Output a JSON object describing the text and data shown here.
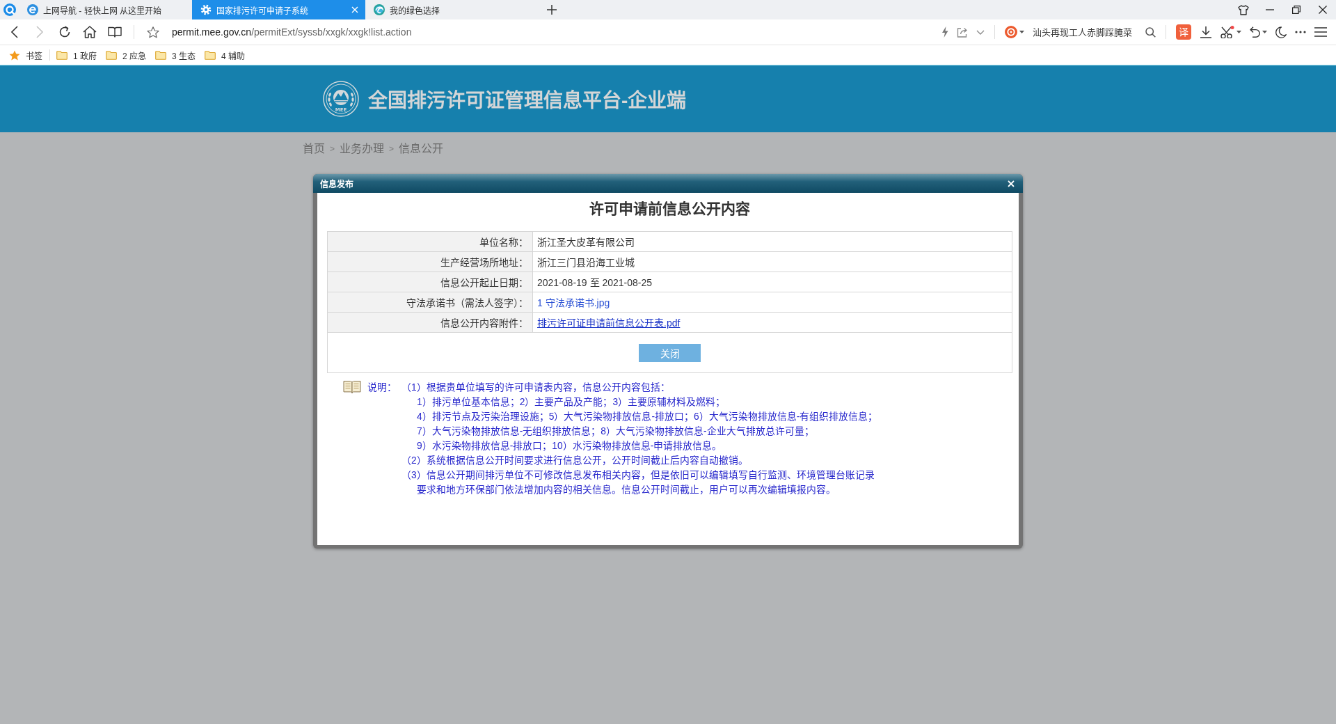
{
  "browser": {
    "tabs": [
      {
        "title": "上网导航 - 轻快上网 从这里开始",
        "kind": "letter",
        "selected": false
      },
      {
        "title": "国家排污许可申请子系统",
        "kind": "gear",
        "selected": true
      },
      {
        "title": "我的绿色选择",
        "kind": "globe",
        "selected": false
      }
    ],
    "forward_disabled": true,
    "address": {
      "domain": "permit.mee.gov.cn",
      "path": "/permitExt/syssb/xxgk/xxgk!list.action"
    },
    "search": {
      "placeholder": "汕头再现工人赤脚踩腌菜"
    },
    "translate_label": "译",
    "bookmarks": [
      {
        "label": "书签",
        "kind": "star"
      },
      {
        "label": "1 政府",
        "kind": "folder"
      },
      {
        "label": "2 应急",
        "kind": "folder"
      },
      {
        "label": "3 生态",
        "kind": "folder"
      },
      {
        "label": "4 辅助",
        "kind": "folder"
      }
    ]
  },
  "header": {
    "logo_text": "MEE",
    "title": "全国排污许可证管理信息平台-企业端"
  },
  "breadcrumb": [
    {
      "label": "首页",
      "kind": "link"
    },
    {
      "label": ">",
      "kind": "separator"
    },
    {
      "label": "业务办理",
      "kind": "link"
    },
    {
      "label": ">",
      "kind": "separator"
    },
    {
      "label": "信息公开",
      "kind": "link"
    }
  ],
  "dialog": {
    "title": "信息发布",
    "heading": "许可申请前信息公开内容",
    "rows": [
      {
        "label": "单位名称：",
        "value": "浙江圣大皮革有限公司",
        "kind": "text"
      },
      {
        "label": "生产经营场所地址：",
        "value": "浙江三门县沿海工业城",
        "kind": "text"
      },
      {
        "label": "信息公开起止日期：",
        "value": "2021-08-19 至 2021-08-25",
        "kind": "text"
      },
      {
        "label": "守法承诺书（需法人签字）：",
        "value": "1 守法承诺书.jpg",
        "kind": "file"
      },
      {
        "label": "信息公开内容附件：",
        "value": "排污许可证申请前信息公开表.pdf",
        "kind": "link"
      }
    ],
    "buttons": [
      "关闭"
    ],
    "notes": {
      "label": "说明：",
      "items": [
        {
          "text": "（1）根据贵单位填写的许可申请表内容，信息公开内容包括：",
          "children": [
            {
              "text": "1）排污单位基本信息；2）主要产品及产能；3）主要原辅材料及燃料；"
            },
            {
              "text": "4）排污节点及污染治理设施；5）大气污染物排放信息-排放口；6）大气污染物排放信息-有组织排放信息；"
            },
            {
              "text": "7）大气污染物排放信息-无组织排放信息；8）大气污染物排放信息-企业大气排放总许可量；"
            },
            {
              "text": "9）水污染物排放信息-排放口；10）水污染物排放信息-申请排放信息。"
            }
          ]
        },
        {
          "text": "（2）系统根据信息公开时间要求进行信息公开，公开时间截止后内容自动撤销。"
        },
        {
          "text": "（3）信息公开期间排污单位不可修改信息发布相关内容，但是依旧可以编辑填写自行监测、环境管理台账记录要求和地方环保部门依法增加内容的相关信息。信息公开时间截止，用户可以再次编辑填报内容。"
        }
      ]
    }
  }
}
